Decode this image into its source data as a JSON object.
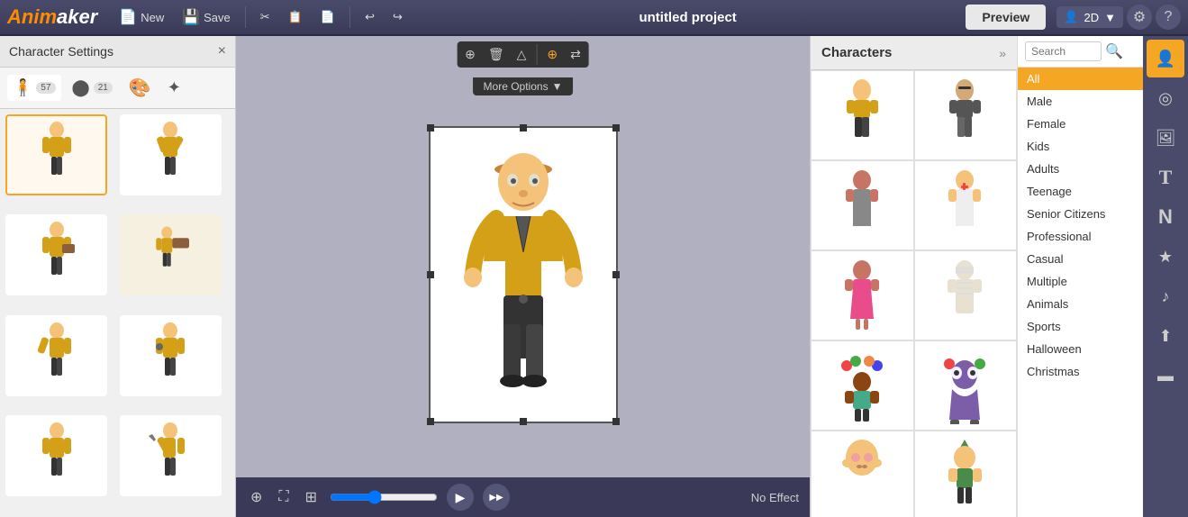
{
  "app": {
    "name": "Anim",
    "name_highlight": "aker",
    "project_title": "untitled project",
    "preview_label": "Preview",
    "view_mode": "2D"
  },
  "toolbar": {
    "new_label": "New",
    "save_label": "Save",
    "undo_icon": "↩",
    "redo_icon": "↪"
  },
  "char_settings": {
    "title": "Character Settings",
    "tabs": [
      {
        "id": "poses",
        "count": 57,
        "icon": "🧍"
      },
      {
        "id": "scenes",
        "count": 21,
        "icon": "⬤"
      },
      {
        "id": "colors",
        "icon": "🎨"
      },
      {
        "id": "effects",
        "icon": "✦"
      }
    ],
    "close_icon": "×"
  },
  "canvas": {
    "more_options": "More Options",
    "controls": [
      "⊕",
      "🗑",
      "△",
      "⊕",
      "⇄"
    ]
  },
  "bottom_bar": {
    "effect_label": "No Effect",
    "play_icon": "▶",
    "next_icon": "▶▶"
  },
  "characters_panel": {
    "title": "Characters",
    "expand_icon": "»"
  },
  "categories": [
    {
      "id": "all",
      "label": "All",
      "active": true
    },
    {
      "id": "male",
      "label": "Male"
    },
    {
      "id": "female",
      "label": "Female"
    },
    {
      "id": "kids",
      "label": "Kids"
    },
    {
      "id": "adults",
      "label": "Adults"
    },
    {
      "id": "teenage",
      "label": "Teenage"
    },
    {
      "id": "senior",
      "label": "Senior Citizens"
    },
    {
      "id": "professional",
      "label": "Professional"
    },
    {
      "id": "casual",
      "label": "Casual"
    },
    {
      "id": "multiple",
      "label": "Multiple"
    },
    {
      "id": "animals",
      "label": "Animals"
    },
    {
      "id": "sports",
      "label": "Sports"
    },
    {
      "id": "halloween",
      "label": "Halloween"
    },
    {
      "id": "christmas",
      "label": "Christmas"
    }
  ],
  "search": {
    "placeholder": "Search"
  },
  "icon_bar": [
    {
      "id": "character",
      "icon": "👤",
      "active": true
    },
    {
      "id": "location",
      "icon": "◎"
    },
    {
      "id": "image",
      "icon": "🖼"
    },
    {
      "id": "text",
      "icon": "T"
    },
    {
      "id": "font",
      "icon": "N"
    },
    {
      "id": "star",
      "icon": "★"
    },
    {
      "id": "music",
      "icon": "♪"
    },
    {
      "id": "upload",
      "icon": "⬆"
    },
    {
      "id": "screen",
      "icon": "▬"
    }
  ]
}
